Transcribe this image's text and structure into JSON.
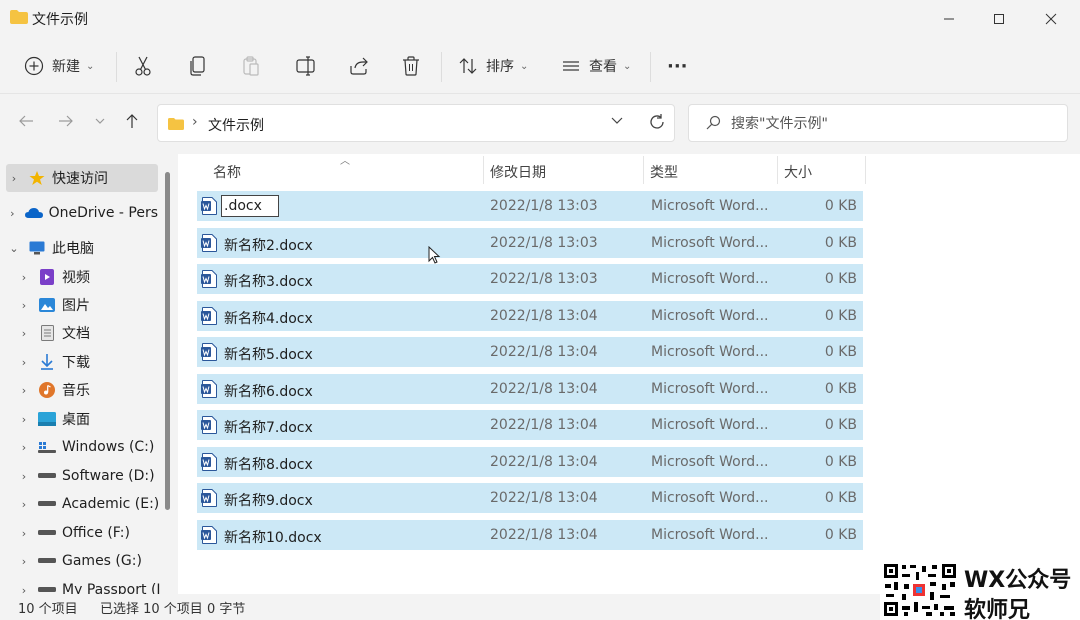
{
  "window": {
    "title": "文件示例"
  },
  "toolbar": {
    "new_label": "新建",
    "sort_label": "排序",
    "view_label": "查看",
    "more_label": "···"
  },
  "address": {
    "path": "文件示例",
    "separator": "›"
  },
  "search": {
    "placeholder": "搜索\"文件示例\""
  },
  "sidebar": {
    "items": [
      {
        "label": "快速访问",
        "icon": "star-icon",
        "color": "#f2b400"
      },
      {
        "label": "OneDrive - Pers",
        "icon": "cloud-icon",
        "color": "#0a64c8"
      },
      {
        "label": "此电脑",
        "icon": "computer-icon",
        "color": "#2a7ad4"
      },
      {
        "label": "视频",
        "icon": "video-icon",
        "color": "#7a3fc8"
      },
      {
        "label": "图片",
        "icon": "picture-icon",
        "color": "#2a87d8"
      },
      {
        "label": "文档",
        "icon": "document-icon",
        "color": "#7a7a7a"
      },
      {
        "label": "下载",
        "icon": "download-icon",
        "color": "#2a7ad4"
      },
      {
        "label": "音乐",
        "icon": "music-icon",
        "color": "#e0762a"
      },
      {
        "label": "桌面",
        "icon": "desktop-icon",
        "color": "#2aa3d8"
      },
      {
        "label": "Windows (C:)",
        "icon": "windows-drive-icon",
        "color": "#555"
      },
      {
        "label": "Software (D:)",
        "icon": "drive-icon",
        "color": "#555"
      },
      {
        "label": "Academic (E:)",
        "icon": "drive-icon",
        "color": "#555"
      },
      {
        "label": "Office (F:)",
        "icon": "drive-icon",
        "color": "#555"
      },
      {
        "label": "Games (G:)",
        "icon": "drive-icon",
        "color": "#555"
      },
      {
        "label": "My Passport (I",
        "icon": "drive-icon",
        "color": "#555"
      }
    ]
  },
  "columns": {
    "name": "名称",
    "date": "修改日期",
    "type": "类型",
    "size": "大小"
  },
  "files": [
    {
      "name": ".docx",
      "date": "2022/1/8 13:03",
      "type": "Microsoft Word...",
      "size": "0 KB",
      "renaming": true
    },
    {
      "name": "新名称2.docx",
      "date": "2022/1/8 13:03",
      "type": "Microsoft Word...",
      "size": "0 KB"
    },
    {
      "name": "新名称3.docx",
      "date": "2022/1/8 13:03",
      "type": "Microsoft Word...",
      "size": "0 KB"
    },
    {
      "name": "新名称4.docx",
      "date": "2022/1/8 13:04",
      "type": "Microsoft Word...",
      "size": "0 KB"
    },
    {
      "name": "新名称5.docx",
      "date": "2022/1/8 13:04",
      "type": "Microsoft Word...",
      "size": "0 KB"
    },
    {
      "name": "新名称6.docx",
      "date": "2022/1/8 13:04",
      "type": "Microsoft Word...",
      "size": "0 KB"
    },
    {
      "name": "新名称7.docx",
      "date": "2022/1/8 13:04",
      "type": "Microsoft Word...",
      "size": "0 KB"
    },
    {
      "name": "新名称8.docx",
      "date": "2022/1/8 13:04",
      "type": "Microsoft Word...",
      "size": "0 KB"
    },
    {
      "name": "新名称9.docx",
      "date": "2022/1/8 13:04",
      "type": "Microsoft Word...",
      "size": "0 KB"
    },
    {
      "name": "新名称10.docx",
      "date": "2022/1/8 13:04",
      "type": "Microsoft Word...",
      "size": "0 KB"
    }
  ],
  "status": {
    "count": "10 个项目",
    "selected": "已选择 10 个项目 0 字节"
  },
  "watermark": {
    "line1": "WX公众号",
    "line2": "软师兄"
  },
  "colors": {
    "selection": "#cce8f6",
    "folder": "#f5c342",
    "word": "#2b579a"
  }
}
